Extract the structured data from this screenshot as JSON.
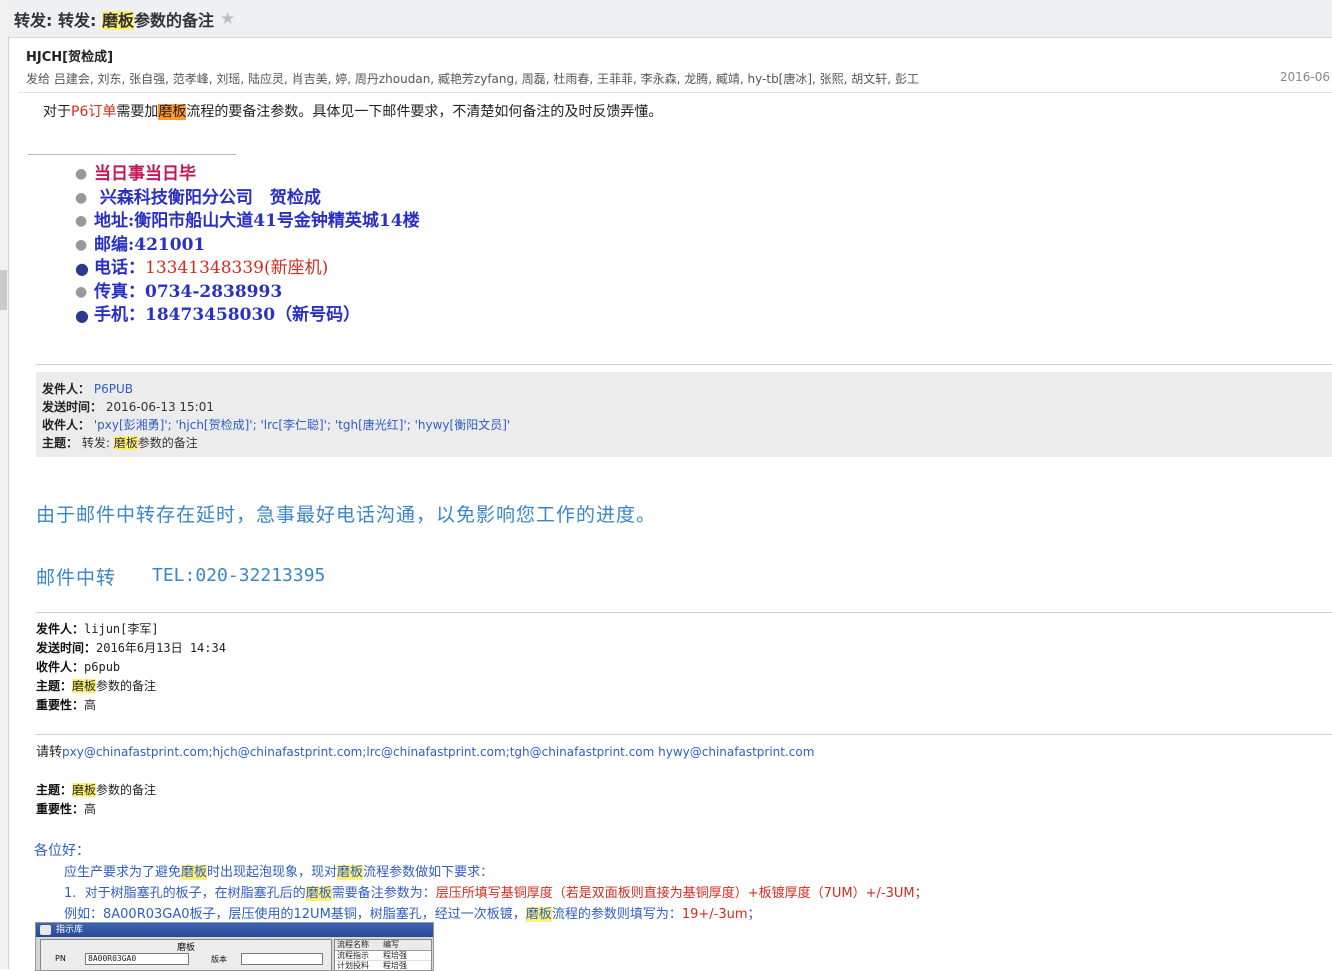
{
  "subject": {
    "prefix": "转发: 转发: ",
    "highlight": "磨板",
    "suffix": "参数的备注"
  },
  "sender": {
    "name": "HJCH[贺检成]"
  },
  "recipients": {
    "label": "发给",
    "list": "吕建会, 刘东, 张自强, 范孝峰, 刘瑶, 陆应灵, 肖吉美, 婷, 周丹zhoudan, 臧艳芳zyfang, 周磊, 杜雨春, 王菲菲, 李永森, 龙腾, 臧靖, hy-tb[唐冰], 张熙, 胡文轩, 彭工"
  },
  "date": "2016-06",
  "intro": {
    "a": "对于",
    "red": "P6订单",
    "b": "需要加",
    "highlight": "磨板",
    "c": "流程的要备注参数。具体见一下邮件要求，不清楚如何备注的及时反馈弄懂。"
  },
  "signature": {
    "motto": "当日事当日毕",
    "company": "兴森科技衡阳分公司　贺检成",
    "address": "地址:衡阳市船山大道41号金钟精英城14楼",
    "postcode": "邮编:421001",
    "phone_label": "电话：",
    "phone_value": "13341348339(新座机)",
    "fax": "传真：0734-2838993",
    "mobile": "手机：18473458030（新号码）"
  },
  "forwarded_header": {
    "from_label": "发件人：",
    "from_value": "P6PUB",
    "sent_label": "发送时间：",
    "sent_value": "2016-06-13 15:01",
    "to_label": "收件人：",
    "to_value": "'pxy[彭湘勇]'; 'hjch[贺检成]'; 'lrc[李仁聪]'; 'tgh[唐光红]'; 'hywy[衡阳文员]'",
    "subj_label": "主题：",
    "subj_prefix": "转发: ",
    "subj_highlight": "磨板",
    "subj_suffix": "参数的备注"
  },
  "relay": {
    "notice": "由于邮件中转存在延时，急事最好电话沟通，以免影响您工作的进度。",
    "label": "邮件中转",
    "tel": "TEL:020-32213395"
  },
  "original_header": {
    "from_label": "发件人：",
    "from_value": "lijun[李军]",
    "sent_label": "发送时间：",
    "sent_value": "2016年6月13日 14:34",
    "to_label": "收件人：",
    "to_value": "p6pub",
    "subj_label": "主题：",
    "subj_highlight": "磨板",
    "subj_suffix": "参数的备注",
    "importance_label": "重要性：",
    "importance_value": "高"
  },
  "forward_request": {
    "lead": "请转",
    "emails": "pxy@chinafastprint.com;hjch@chinafastprint.com;lrc@chinafastprint.com;tgh@chinafastprint.com hywy@chinafastprint.com"
  },
  "body_header": {
    "subj_label": "主题：",
    "subj_highlight": "磨板",
    "subj_suffix": "参数的备注",
    "importance_label": "重要性：",
    "importance_value": "高"
  },
  "body": {
    "greeting": "各位好：",
    "req_a": "应生产要求为了避免",
    "req_hl1": "磨板",
    "req_b": "时出现起泡现象，现对",
    "req_hl2": "磨板",
    "req_c": "流程参数做如下要求：",
    "item_num": "1.",
    "item_a": "对于树脂塞孔的板子，在树脂塞孔后的",
    "item_hl": "磨板",
    "item_b": "需要备注参数为：",
    "item_red": "层压所填写基铜厚度（若是双面板则直接为基铜厚度）+板镀厚度（7UM）+/-3UM；",
    "ex_a": "例如：8A00R03GA0板子，层压使用的12UM基铜，树脂塞孔，经过一次板镀，",
    "ex_hl": "磨板",
    "ex_b": "流程的参数则填写为：",
    "ex_red": "19+/-3um",
    "ex_end": "；"
  },
  "embedded_screenshot": {
    "window_title": "指示库",
    "panel_title": "磨板",
    "pn_label": "PN",
    "pn_value": "8A00R03GA0",
    "version_label": "版本",
    "grid_col1": "流程名称",
    "grid_col2": "编写",
    "grid_row1_c1": "流程指示",
    "grid_row1_c2": "程培强",
    "grid_row2_c1": "计划投料",
    "grid_row2_c2": "程培强"
  }
}
